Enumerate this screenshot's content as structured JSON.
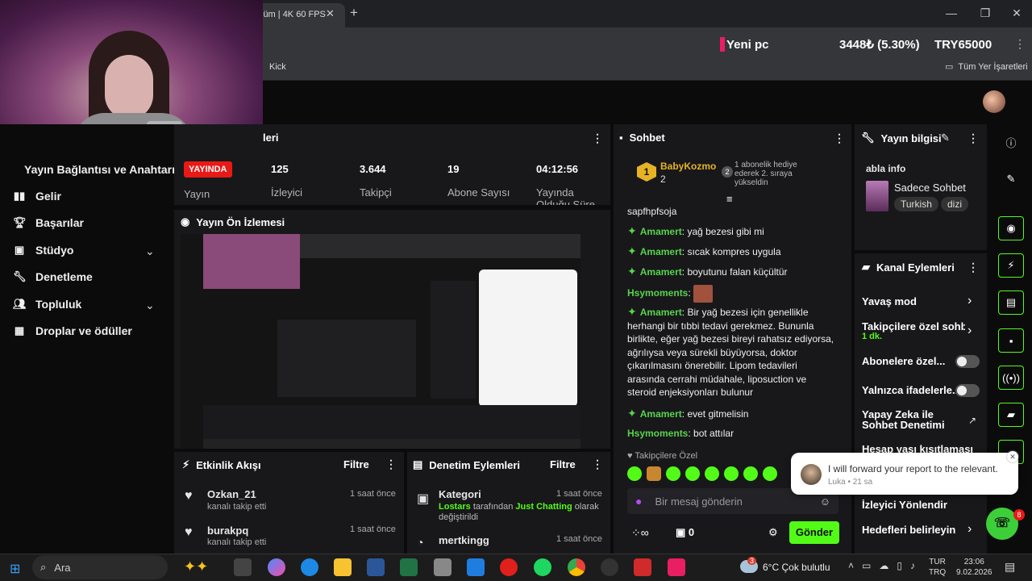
{
  "browser": {
    "tab_title": "lüm | 4K 60 FPS",
    "bookmark": "Kick",
    "all_bookmarks": "Tüm Yer İşaretleri",
    "ticker": {
      "label": "Yeni pc",
      "change": "3448₺ (5.30%)",
      "symbol": "TRY65000"
    }
  },
  "sidebar": {
    "items": [
      {
        "label": "Yayın Bağlantısı ve Anahtarı",
        "icon": "key-icon"
      },
      {
        "label": "Gelir",
        "icon": "chart-icon"
      },
      {
        "label": "Başarılar",
        "icon": "trophy-icon"
      },
      {
        "label": "Stüdyo",
        "icon": "studio-icon"
      },
      {
        "label": "Denetleme",
        "icon": "wrench-icon"
      },
      {
        "label": "Topluluk",
        "icon": "people-icon"
      },
      {
        "label": "Droplar ve ödüller",
        "icon": "gift-icon"
      }
    ]
  },
  "stats": {
    "title": "leri",
    "live_badge": "YAYINDA",
    "live_label": "Yayın",
    "items": [
      {
        "value": "125",
        "label": "İzleyici"
      },
      {
        "value": "3.644",
        "label": "Takipçi"
      },
      {
        "value": "19",
        "label": "Abone Sayısı"
      },
      {
        "value": "04:12:56",
        "label": "Yayında Olduğu Süre"
      }
    ]
  },
  "preview": {
    "title": "Yayın Ön İzlemesi"
  },
  "activity": {
    "title": "Etkinlik Akışı",
    "filter": "Filtre",
    "events": [
      {
        "user": "Ozkan_21",
        "action": "kanalı takip etti",
        "time": "1 saat önce"
      },
      {
        "user": "burakpq",
        "action": "kanalı takip etti",
        "time": "1 saat önce"
      }
    ]
  },
  "moderation": {
    "title": "Denetim Eylemleri",
    "filter": "Filtre",
    "items": [
      {
        "title": "Kategori",
        "time": "1 saat önce",
        "actor": "Lostars",
        "mid": "tarafından",
        "target": "Just Chatting",
        "end": "olarak değiştirildi"
      },
      {
        "title": "mertkingg",
        "time": "1 saat önce"
      }
    ]
  },
  "chat": {
    "title": "Sohbet",
    "pinned_user": "BabyKozmo",
    "pinned_count": "2",
    "pinned_badge": "2",
    "pinned_text": "1 abonelik hediye ederek 2. sıraya yükseldin",
    "messages": [
      {
        "user": "",
        "text": "sapfhpfsoja"
      },
      {
        "user": "Amamert",
        "text": "yağ bezesi gibi mi"
      },
      {
        "user": "Amamert",
        "text": "sıcak kompres uygula"
      },
      {
        "user": "Amamert",
        "text": "boyutunu falan küçültür"
      },
      {
        "user": "Hsymoments",
        "text": ""
      },
      {
        "user": "Amamert",
        "text": "Bir yağ bezesi için genellikle herhangi bir tıbbi tedavi gerekmez. Bununla birlikte, eğer yağ bezesi bireyi rahatsız ediyorsa, ağrılıysa veya sürekli büyüyorsa, doktor çıkarılmasını önerebilir. Lipom tedavileri arasında cerrahi müdahale, liposuction ve steroid enjeksiyonları bulunur"
      },
      {
        "user": "Amamert",
        "text": "evet gitmelisin"
      },
      {
        "user": "Hsymoments",
        "text": "bot attılar"
      }
    ],
    "followers_only": "Takipçilere Özel",
    "input_placeholder": "Bir mesaj gönderin",
    "points": "0",
    "send": "Gönder"
  },
  "stream_info": {
    "title": "Yayın bilgisi",
    "stream_title": "abla info",
    "category": "Sadece Sohbet",
    "tags": [
      "Turkish",
      "dizi"
    ]
  },
  "channel_actions": {
    "title": "Kanal Eylemleri",
    "items": [
      {
        "label": "Yavaş mod"
      },
      {
        "label": "Takipçilere özel sohbe",
        "sub": "1 dk."
      },
      {
        "label": "Abonelere özel..."
      },
      {
        "label": "Yalnızca ifadelerle..."
      },
      {
        "label": "Yapay Zeka ile Sohbet Denetimi"
      },
      {
        "label": "Hesap yaşı kısıtlaması"
      },
      {
        "label": "İzleyici Yönlendir"
      },
      {
        "label": "Hedefleri belirleyin"
      }
    ]
  },
  "toast": {
    "text": "I will forward your report to the relevant...",
    "author": "Luka",
    "time": "21 sa"
  },
  "support_badge": "8",
  "taskbar": {
    "search": "Ara",
    "weather": "6°C Çok bulutlu",
    "weather_badge": "3",
    "lang1": "TUR",
    "lang2": "TRQ",
    "time": "23:06",
    "date": "9.02.2026"
  },
  "colors": {
    "accent": "#53fc18",
    "live": "#e91916",
    "panel": "#18181b"
  }
}
